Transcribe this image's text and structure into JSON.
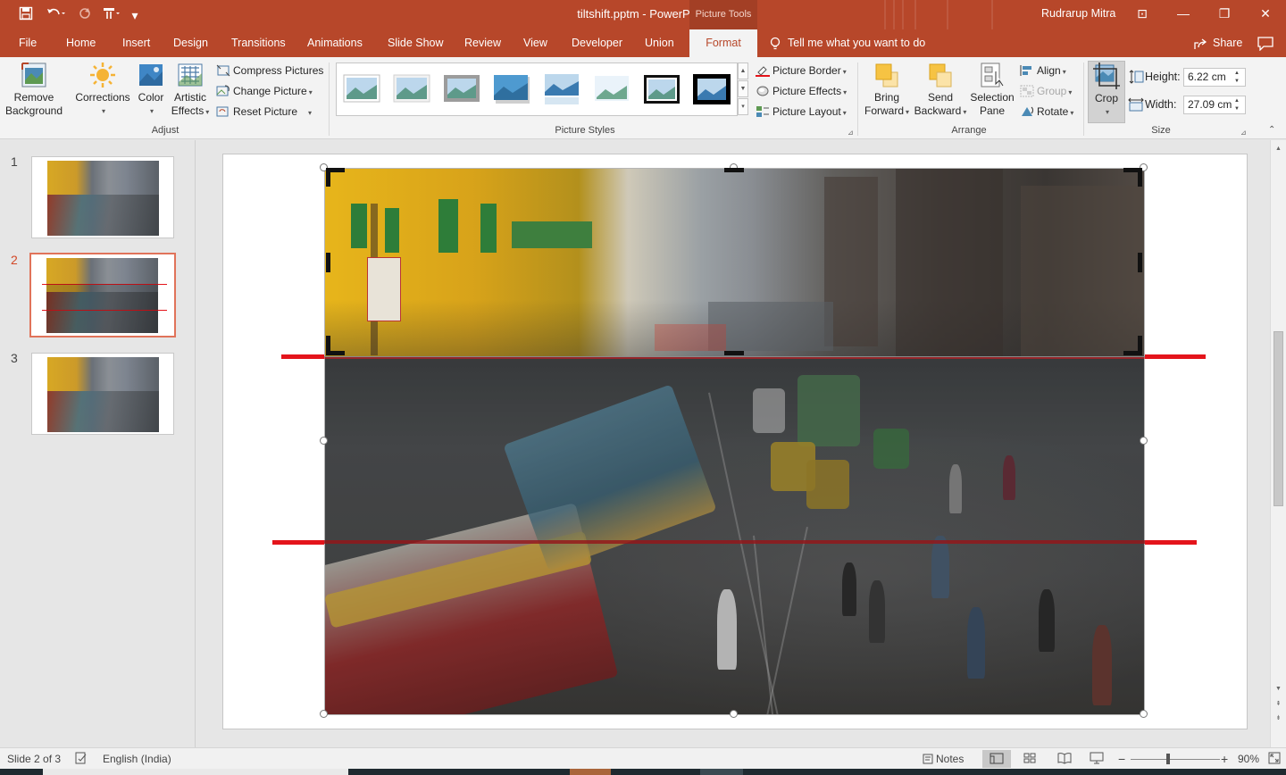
{
  "window": {
    "title": "tiltshift.pptm  -  PowerPoint",
    "contextual_tab": "Picture Tools",
    "user": "Rudrarup Mitra",
    "controls": {
      "restore_ribbon": "⊡",
      "minimize": "—",
      "maximize": "❐",
      "close": "✕"
    },
    "quick_access": {
      "save": "save-icon",
      "undo": "undo-icon",
      "redo": "redo-icon",
      "touch": "touch-mode-icon",
      "customize": "▾"
    }
  },
  "tabs": [
    "File",
    "Home",
    "Insert",
    "Design",
    "Transitions",
    "Animations",
    "Slide Show",
    "Review",
    "View",
    "Developer",
    "Union",
    "Format"
  ],
  "active_tab": "Format",
  "tell_me": "Tell me what you want to do",
  "share": "Share",
  "ribbon": {
    "adjust": {
      "label": "Adjust",
      "remove_background": [
        "Remove",
        "Background"
      ],
      "corrections": "Corrections",
      "color": "Color",
      "artistic_effects": [
        "Artistic",
        "Effects"
      ],
      "compress": "Compress Pictures",
      "change": "Change Picture",
      "reset": "Reset Picture"
    },
    "picture_styles": {
      "label": "Picture Styles",
      "border": "Picture Border",
      "effects": "Picture Effects",
      "layout": "Picture Layout"
    },
    "arrange": {
      "label": "Arrange",
      "bring_forward": [
        "Bring",
        "Forward"
      ],
      "send_backward": [
        "Send",
        "Backward"
      ],
      "selection_pane": [
        "Selection",
        "Pane"
      ],
      "align": "Align",
      "group": "Group",
      "rotate": "Rotate"
    },
    "size": {
      "label": "Size",
      "crop": "Crop",
      "height_label": "Height:",
      "height_value": "6.22 cm",
      "width_label": "Width:",
      "width_value": "27.09 cm"
    }
  },
  "slides": [
    {
      "number": "1"
    },
    {
      "number": "2",
      "selected": true
    },
    {
      "number": "3"
    }
  ],
  "status": {
    "slide_info": "Slide 2 of 3",
    "language": "English (India)",
    "notes": "Notes",
    "zoom": "90%"
  },
  "colors": {
    "accent": "#b7472a",
    "guide_line": "#e4141b"
  }
}
